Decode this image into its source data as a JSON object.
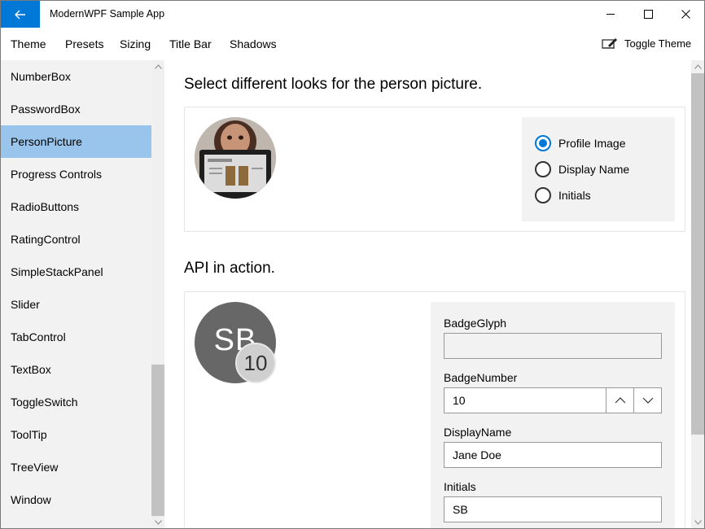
{
  "window": {
    "title": "ModernWPF Sample App",
    "accent": "#0078d7"
  },
  "menu": {
    "items": [
      "Theme",
      "Presets",
      "Sizing",
      "Title Bar",
      "Shadows"
    ],
    "toggle_theme": "Toggle Theme"
  },
  "sidebar": {
    "items": [
      {
        "label": "NumberBox"
      },
      {
        "label": "PasswordBox"
      },
      {
        "label": "PersonPicture",
        "selected": true
      },
      {
        "label": "Progress Controls"
      },
      {
        "label": "RadioButtons"
      },
      {
        "label": "RatingControl"
      },
      {
        "label": "SimpleStackPanel"
      },
      {
        "label": "Slider"
      },
      {
        "label": "TabControl"
      },
      {
        "label": "TextBox"
      },
      {
        "label": "ToggleSwitch"
      },
      {
        "label": "ToolTip"
      },
      {
        "label": "TreeView"
      },
      {
        "label": "Window"
      }
    ],
    "selected_color": "#99c5ec"
  },
  "main": {
    "section1": {
      "title": "Select different looks for the person picture.",
      "options": [
        {
          "label": "Profile Image",
          "checked": true
        },
        {
          "label": "Display Name",
          "checked": false
        },
        {
          "label": "Initials",
          "checked": false
        }
      ]
    },
    "section2": {
      "title": "API in action.",
      "avatar_initials": "SB",
      "badge_number_display": "10",
      "fields": {
        "badge_glyph_label": "BadgeGlyph",
        "badge_glyph_value": "",
        "badge_number_label": "BadgeNumber",
        "badge_number_value": "10",
        "display_name_label": "DisplayName",
        "display_name_value": "Jane Doe",
        "initials_label": "Initials",
        "initials_value": "SB"
      }
    }
  }
}
